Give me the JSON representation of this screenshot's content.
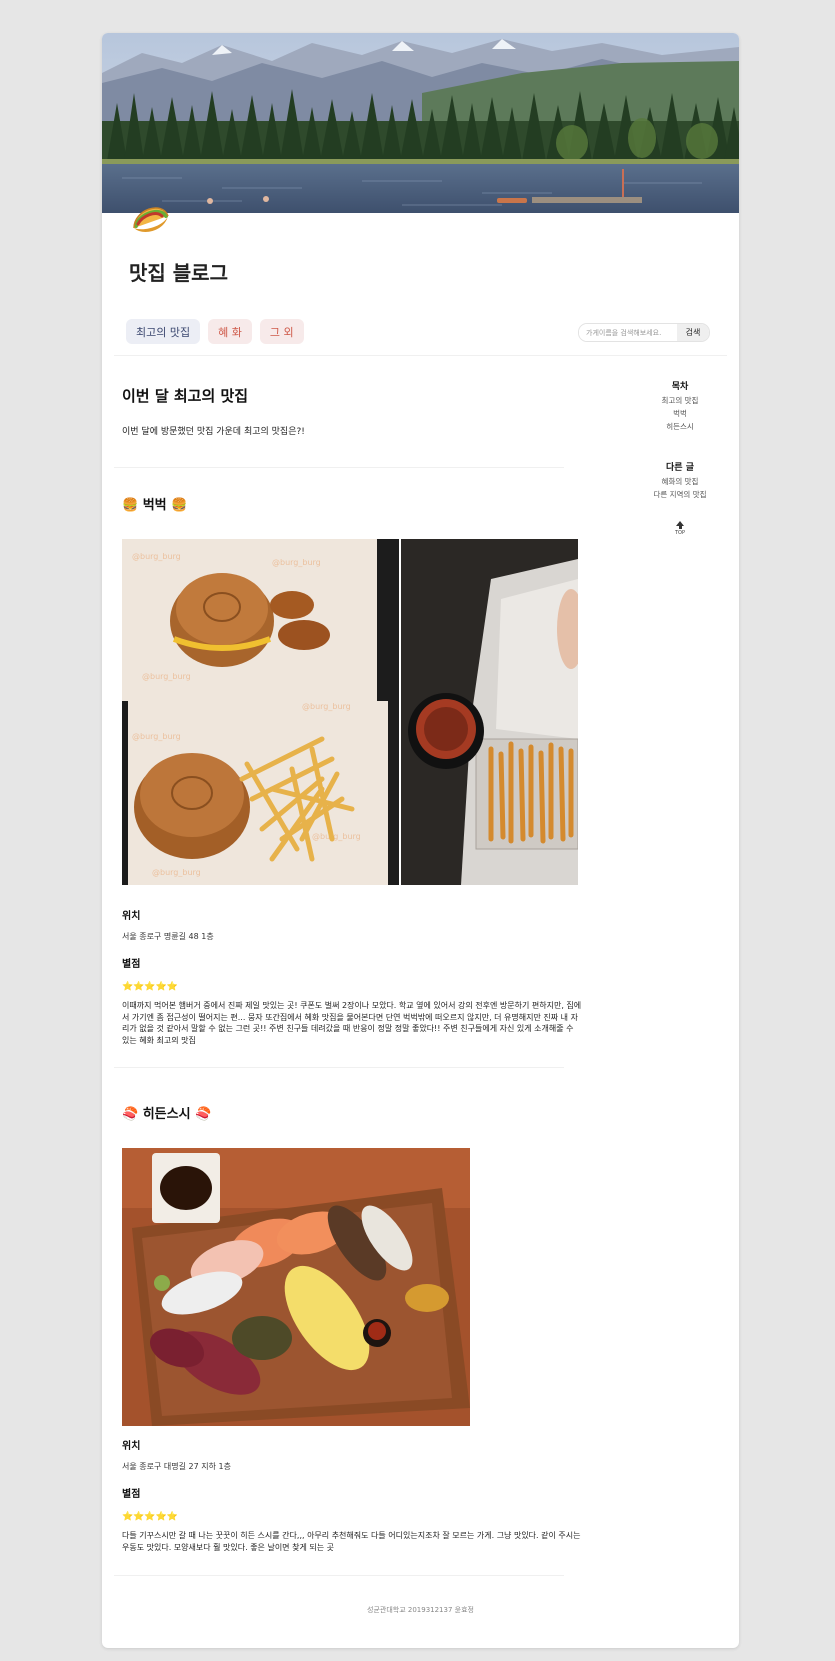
{
  "blog": {
    "title": "맛집 블로그",
    "icon": "taco-icon"
  },
  "nav": {
    "items": [
      {
        "label": "최고의 맛집",
        "color": "#3c4870"
      },
      {
        "label": "혜 화",
        "color": "#cf5a4a"
      },
      {
        "label": "그 외",
        "color": "#cf5a4a"
      }
    ]
  },
  "search": {
    "placeholder": "가게이름을 검색해보세요.",
    "button_label": "검색"
  },
  "intro": {
    "title": "이번 달 최고의 맛집",
    "subtitle": "이번 달에 방문했던 맛집 가운데 최고의 맛집은?!"
  },
  "sections": [
    {
      "title": "🍔 벅벅 🍔",
      "location_label": "위치",
      "location": "서울 종로구 명륜길 48 1층",
      "rating_label": "별점",
      "stars": "⭐⭐⭐⭐⭐",
      "rating": 5,
      "description": "이때까지 먹어본 햄버거 중에서 진짜 제일 맛있는 곳! 쿠폰도 벌써 2장이나 모았다. 학교 옆에 있어서 강의 전후엔 방문하기 편하지만, 집에서 가기엔 좀 접근성이 떨어지는 편... 뭉자 또간집에서 혜화 맛집을 물어본다면 단연 벅벅밖에 떠오르지 않지만, 더 유명해지만 진짜 내 자리가 없을 것 같아서 말할 수 없는 그런 곳!! 주변 친구들 데려갔을 때 반응이 정말 정말 좋았다!! 주변 친구들에게 자신 있게 소개해줄 수 있는 혜화 최고의 맛집",
      "photo_watermark": "@burg_burg"
    },
    {
      "title": "🍣 히든스시 🍣",
      "location_label": "위치",
      "location": "서울 종로구 대명길 27 지하 1층",
      "rating_label": "별점",
      "stars": "⭐⭐⭐⭐⭐",
      "rating": 5,
      "description": "다들 기꾸스시만 갈 때 나는 꿋꿋이 히든 스시를 간다,,, 아무리 추천해줘도 다들 어디있는지조차 잘 모르는 가게. 그냥 맛있다. 같이 주시는 우동도 맛있다. 모양새보다 훨 맛있다. 좋은 날이면 찾게 되는 곳"
    }
  ],
  "sidebar": {
    "toc_title": "목차",
    "toc_items": [
      "최고의 맛집",
      "벅벅",
      "히든스시"
    ],
    "other_title": "다른 글",
    "other_items": [
      "혜화의 맛집",
      "다른 지역의 맛집"
    ],
    "top_label": "TOP"
  },
  "footer": {
    "text": "성균관대학교 2019312137 윤효정"
  }
}
